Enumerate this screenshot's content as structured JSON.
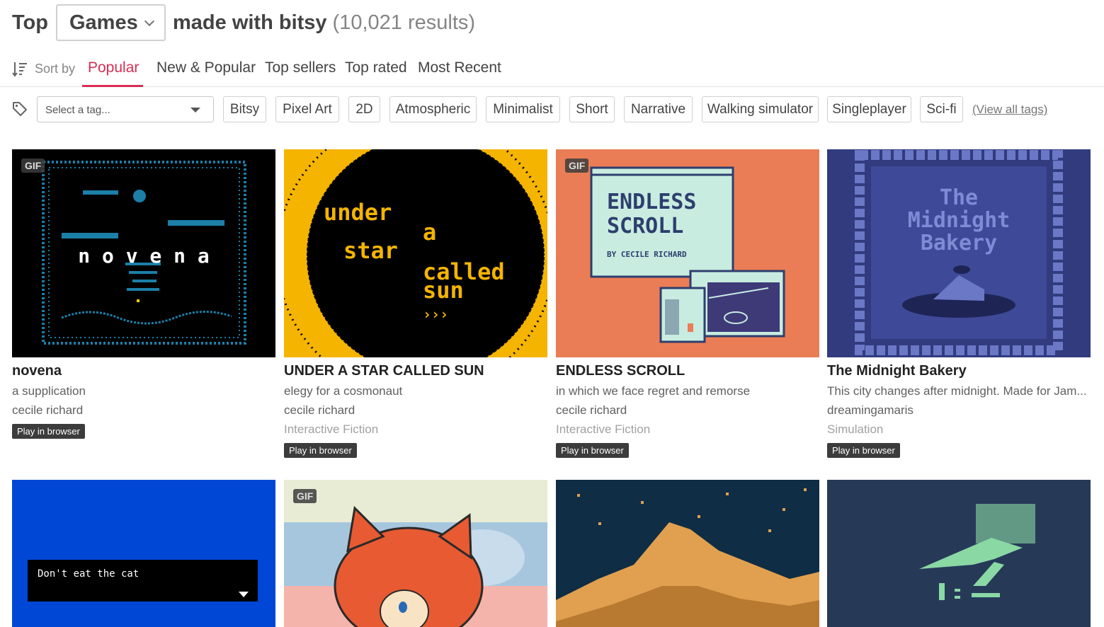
{
  "header": {
    "top": "Top",
    "category": "Games",
    "made_with": "made with bitsy",
    "count": "(10,021 results)"
  },
  "sort": {
    "label": "Sort by",
    "tabs": [
      "Popular",
      "New & Popular",
      "Top sellers",
      "Top rated",
      "Most Recent"
    ],
    "active": "Popular"
  },
  "tags": {
    "placeholder": "Select a tag...",
    "items": [
      "Bitsy",
      "Pixel Art",
      "2D",
      "Atmospheric",
      "Minimalist",
      "Short",
      "Narrative",
      "Walking simulator",
      "Singleplayer",
      "Sci-fi"
    ],
    "view_all": "(View all tags)"
  },
  "games": [
    {
      "title": "novena",
      "desc": "a supplication",
      "author": "cecile richard",
      "genre": "",
      "badge": "Play in browser",
      "gif": "GIF",
      "cover_text": "n o v e n a"
    },
    {
      "title": "UNDER A STAR CALLED SUN",
      "desc": "elegy for a cosmonaut",
      "author": "cecile richard",
      "genre": "Interactive Fiction",
      "badge": "Play in browser",
      "gif": "",
      "cover_lines": [
        "under",
        "a",
        "star",
        "called",
        "sun",
        "›››"
      ]
    },
    {
      "title": "ENDLESS SCROLL",
      "desc": "in which we face regret and remorse",
      "author": "cecile richard",
      "genre": "Interactive Fiction",
      "badge": "Play in browser",
      "gif": "GIF",
      "cover_lines": [
        "ENDLESS",
        "SCROLL",
        "BY CECILE RICHARD"
      ]
    },
    {
      "title": "The Midnight Bakery",
      "desc": "This city changes after midnight. Made for Jam...",
      "author": "dreamingamaris",
      "genre": "Simulation",
      "badge": "Play in browser",
      "gif": "",
      "cover_lines": [
        "The",
        "Midnight",
        "Bakery"
      ]
    },
    {
      "gif": "",
      "cover_text": "Don't eat the cat"
    },
    {
      "gif": "GIF"
    },
    {
      "gif": ""
    },
    {
      "gif": ""
    }
  ],
  "colors": {
    "accent": "#da2c53",
    "novena_bg": "#000000",
    "novena_fg": "#1b7fa8",
    "sun_yellow": "#f4b400",
    "scroll_orange": "#ea7d55",
    "scroll_mint": "#c8ede0",
    "bakery_navy": "#2b3470",
    "cat_blue": "#0047d6",
    "mountain_teal": "#0f2d44",
    "green_navy": "#263a58"
  }
}
